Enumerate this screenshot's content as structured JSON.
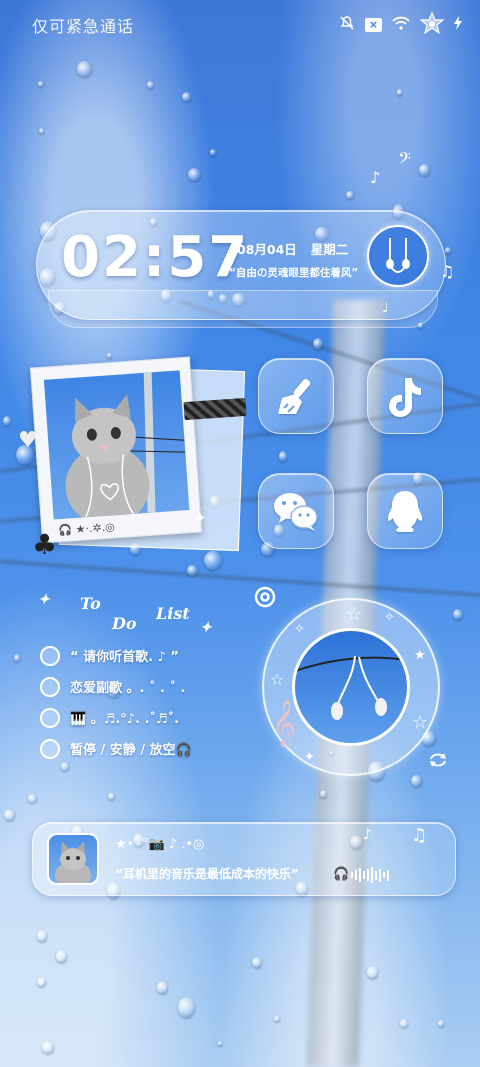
{
  "status_bar": {
    "carrier_text": "仅可紧急通话",
    "icons": [
      "mute-icon",
      "sim-disabled-icon",
      "wifi-icon",
      "battery-icon",
      "charging-icon"
    ],
    "sim_label": "×"
  },
  "clock_widget": {
    "time": "02:57",
    "date": "08月04日",
    "weekday": "星期二",
    "quote": "“自由の灵魂眼里都住着风”",
    "icon": "earphones-icon"
  },
  "photo_widget": {
    "caption": "🎧 ★·.✲.◎",
    "icons": [
      "cat-photo",
      "heart-charm-icon",
      "clover-icon",
      "tape-icon"
    ]
  },
  "apps": [
    {
      "name": "cleaner",
      "icon": "broom-icon"
    },
    {
      "name": "tiktok",
      "icon": "tiktok-icon"
    },
    {
      "name": "wechat",
      "icon": "wechat-icon"
    },
    {
      "name": "qq",
      "icon": "qq-penguin-icon"
    }
  ],
  "todo": {
    "title_words": [
      "To",
      "Do",
      "List"
    ],
    "items": [
      "“ 请你听首歌.    ♪ ”",
      "恋爱副歌 。. ˚ .  ˚ .",
      "🎹 。♬.°♪.  .˚♬˚.",
      "暂停 / 安静 / 放空🎧"
    ]
  },
  "disc_widget": {
    "icons": [
      "music-app-icon",
      "treble-clef-icon",
      "repeat-icon",
      "earphones-on-wire-photo"
    ]
  },
  "music_bar": {
    "deco": "★•◦°📷  ♪ .•◎",
    "text": "“耳机里的音乐是最低成本的快乐”",
    "icons": [
      "album-cat-photo",
      "headphones-icon",
      "waveform-icon"
    ]
  },
  "colors": {
    "sky_top": "#3d78d8",
    "sky_bottom": "#aacdf2",
    "accent": "#2f74de"
  }
}
